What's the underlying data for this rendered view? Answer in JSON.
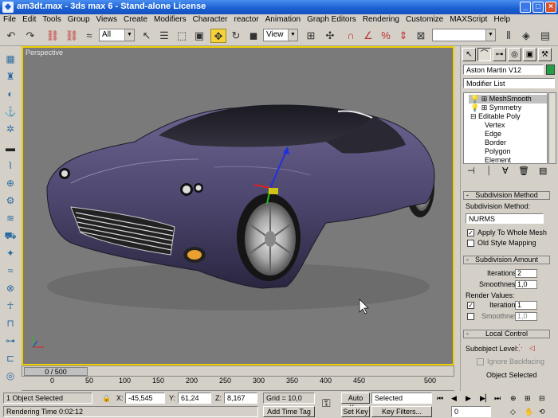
{
  "window": {
    "title": "am3dt.max - 3ds max 6 - Stand-alone License"
  },
  "menu": [
    "File",
    "Edit",
    "Tools",
    "Group",
    "Views",
    "Create",
    "Modifiers",
    "Character",
    "reactor",
    "Animation",
    "Graph Editors",
    "Rendering",
    "Customize",
    "MAXScript",
    "Help"
  ],
  "toolbar": {
    "selection_filter": "All",
    "ref_coord": "View"
  },
  "viewport": {
    "label": "Perspective"
  },
  "timeline": {
    "frame_label": "0 / 500",
    "ticks": [
      "0",
      "50",
      "100",
      "150",
      "200",
      "250",
      "300",
      "350",
      "400",
      "450",
      "500"
    ]
  },
  "status": {
    "selection": "1 Object Selected",
    "render_time": "Rendering Time  0:02:12",
    "x_label": "X:",
    "x_value": "-45,545",
    "y_label": "Y:",
    "y_value": "61,24",
    "z_label": "Z:",
    "z_value": "8,167",
    "grid": "Grid = 10,0",
    "add_time_tag": "Add Time Tag",
    "auto_key": "Auto Key",
    "set_key": "Set Key",
    "key_mode": "Selected",
    "key_filters": "Key Filters...",
    "current_frame": "0"
  },
  "panel": {
    "object_name": "Aston Martin V12",
    "object_color": "#22a046",
    "modifier_list": "Modifier List",
    "stack": [
      {
        "label": "MeshSmooth",
        "level": "mod"
      },
      {
        "label": "Symmetry",
        "level": "mod"
      },
      {
        "label": "Editable Poly",
        "level": "base"
      },
      {
        "label": "Vertex",
        "level": "sub"
      },
      {
        "label": "Edge",
        "level": "sub"
      },
      {
        "label": "Border",
        "level": "sub"
      },
      {
        "label": "Polygon",
        "level": "sub"
      },
      {
        "label": "Element",
        "level": "sub"
      }
    ],
    "subdiv_method_title": "Subdivision Method",
    "subdiv_method_label": "Subdivision Method:",
    "subdiv_method_value": "NURMS",
    "apply_whole_mesh": "Apply To Whole Mesh",
    "old_style_mapping": "Old Style Mapping",
    "subdiv_amount_title": "Subdivision Amount",
    "iterations_label": "Iterations:",
    "iterations_value": "2",
    "smoothness_label": "Smoothness:",
    "smoothness_value": "1,0",
    "render_values_label": "Render Values:",
    "render_iterations_label": "Iterations",
    "render_iterations_value": "1",
    "render_smoothness_label": "Smoothness",
    "render_smoothness_value": "1,0",
    "local_control_title": "Local Control",
    "subobject_level_label": "Subobject Level:",
    "ignore_backfacing": "Ignore Backfacing",
    "object_selected": "Object Selected"
  }
}
